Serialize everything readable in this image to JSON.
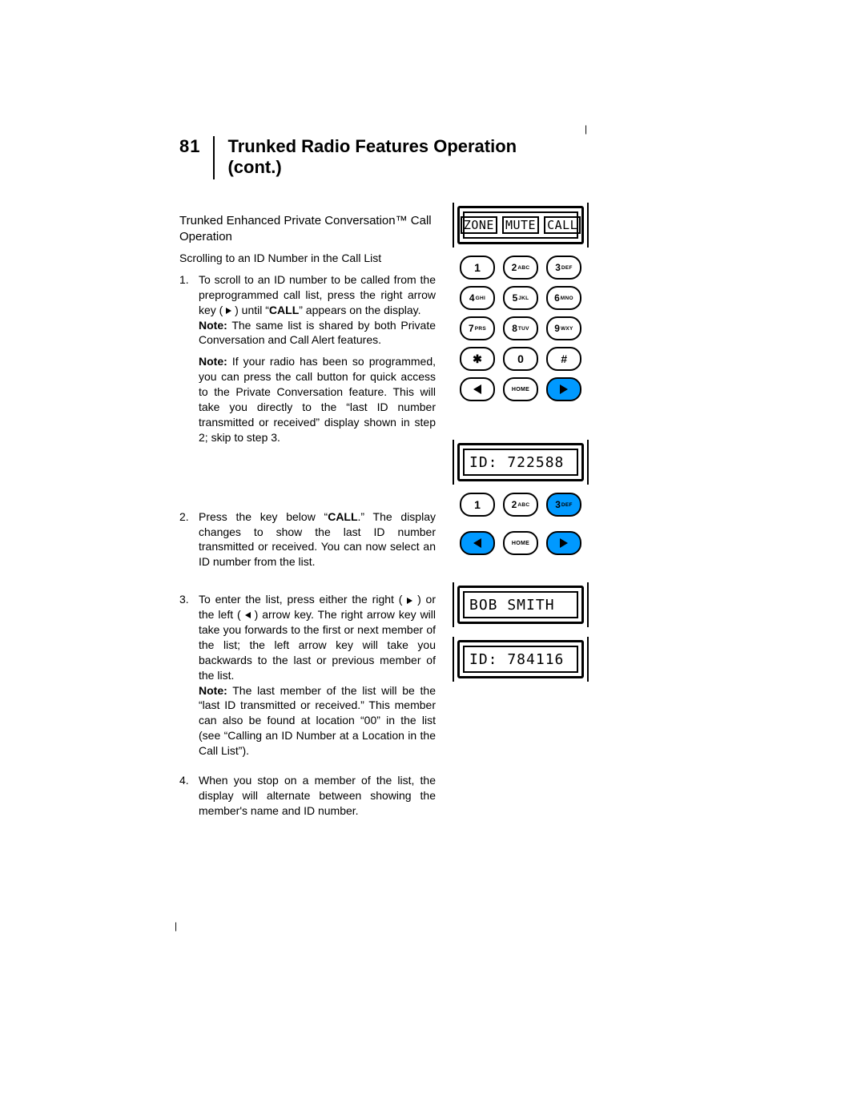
{
  "page_number": "81",
  "title_line1": "Trunked Radio Features Operation",
  "title_line2": "(cont.)",
  "sections": {
    "heading": "Trunked Enhanced Private Conversation™ Call Operation",
    "subheading": "Scrolling to an ID Number in the Call List",
    "step1": {
      "num": "1.",
      "text_a": "To scroll to an ID number to be called from the preprogrammed call list, press the right arrow key ( ",
      "text_b": " ) until “",
      "bold_b": "CALL",
      "text_c": "” appears on the display.",
      "note1_label": "Note:",
      "note1_text": " The same list is shared by both Private Conversation and Call Alert features.",
      "note2_label": "Note:",
      "note2_text": " If your radio has been so programmed, you can press the call button for quick access to the Private Conversation feature. This will take you directly to the “last ID number transmitted or received” display shown in step 2; skip to step 3."
    },
    "step2": {
      "num": "2.",
      "text_a": "Press the key below “",
      "bold_a": "CALL",
      "text_b": ".” The display changes to show the last ID number transmitted or received. You can now select an ID number from the list."
    },
    "step3": {
      "num": "3.",
      "text_a": "To enter the list, press either the right ( ",
      "text_b": " ) or the left ( ",
      "text_c": " ) arrow key. The right arrow key will take you forwards to the first or next member of the list; the left arrow key will take you backwards to the last or previous member of the list.",
      "note_label": "Note:",
      "note_text": " The last member of the list will be the “last ID transmitted or received.” This member can also be found at location “00” in the list (see “Calling an ID Number at a Location in the Call List”)."
    },
    "step4": {
      "num": "4.",
      "text": "When you stop on a member of the list, the display will alternate between showing the member's name and ID number."
    }
  },
  "displays": {
    "menu": {
      "soft1": "ZONE",
      "soft2": "MUTE",
      "soft3": "CALL"
    },
    "id1": "ID: 722588",
    "name": "BOB SMITH",
    "id2": "ID: 784116"
  },
  "keypad": {
    "k1": "1",
    "k2": "2",
    "k2s": "ABC",
    "k3": "3",
    "k3s": "DEF",
    "k4": "4",
    "k4s": "GHI",
    "k5": "5",
    "k5s": "JKL",
    "k6": "6",
    "k6s": "MNO",
    "k7": "7",
    "k7s": "PRS",
    "k8": "8",
    "k8s": "TUV",
    "k9": "9",
    "k9s": "WXY",
    "k0": "0",
    "star": "✱",
    "hash": "#",
    "home": "HOME"
  }
}
